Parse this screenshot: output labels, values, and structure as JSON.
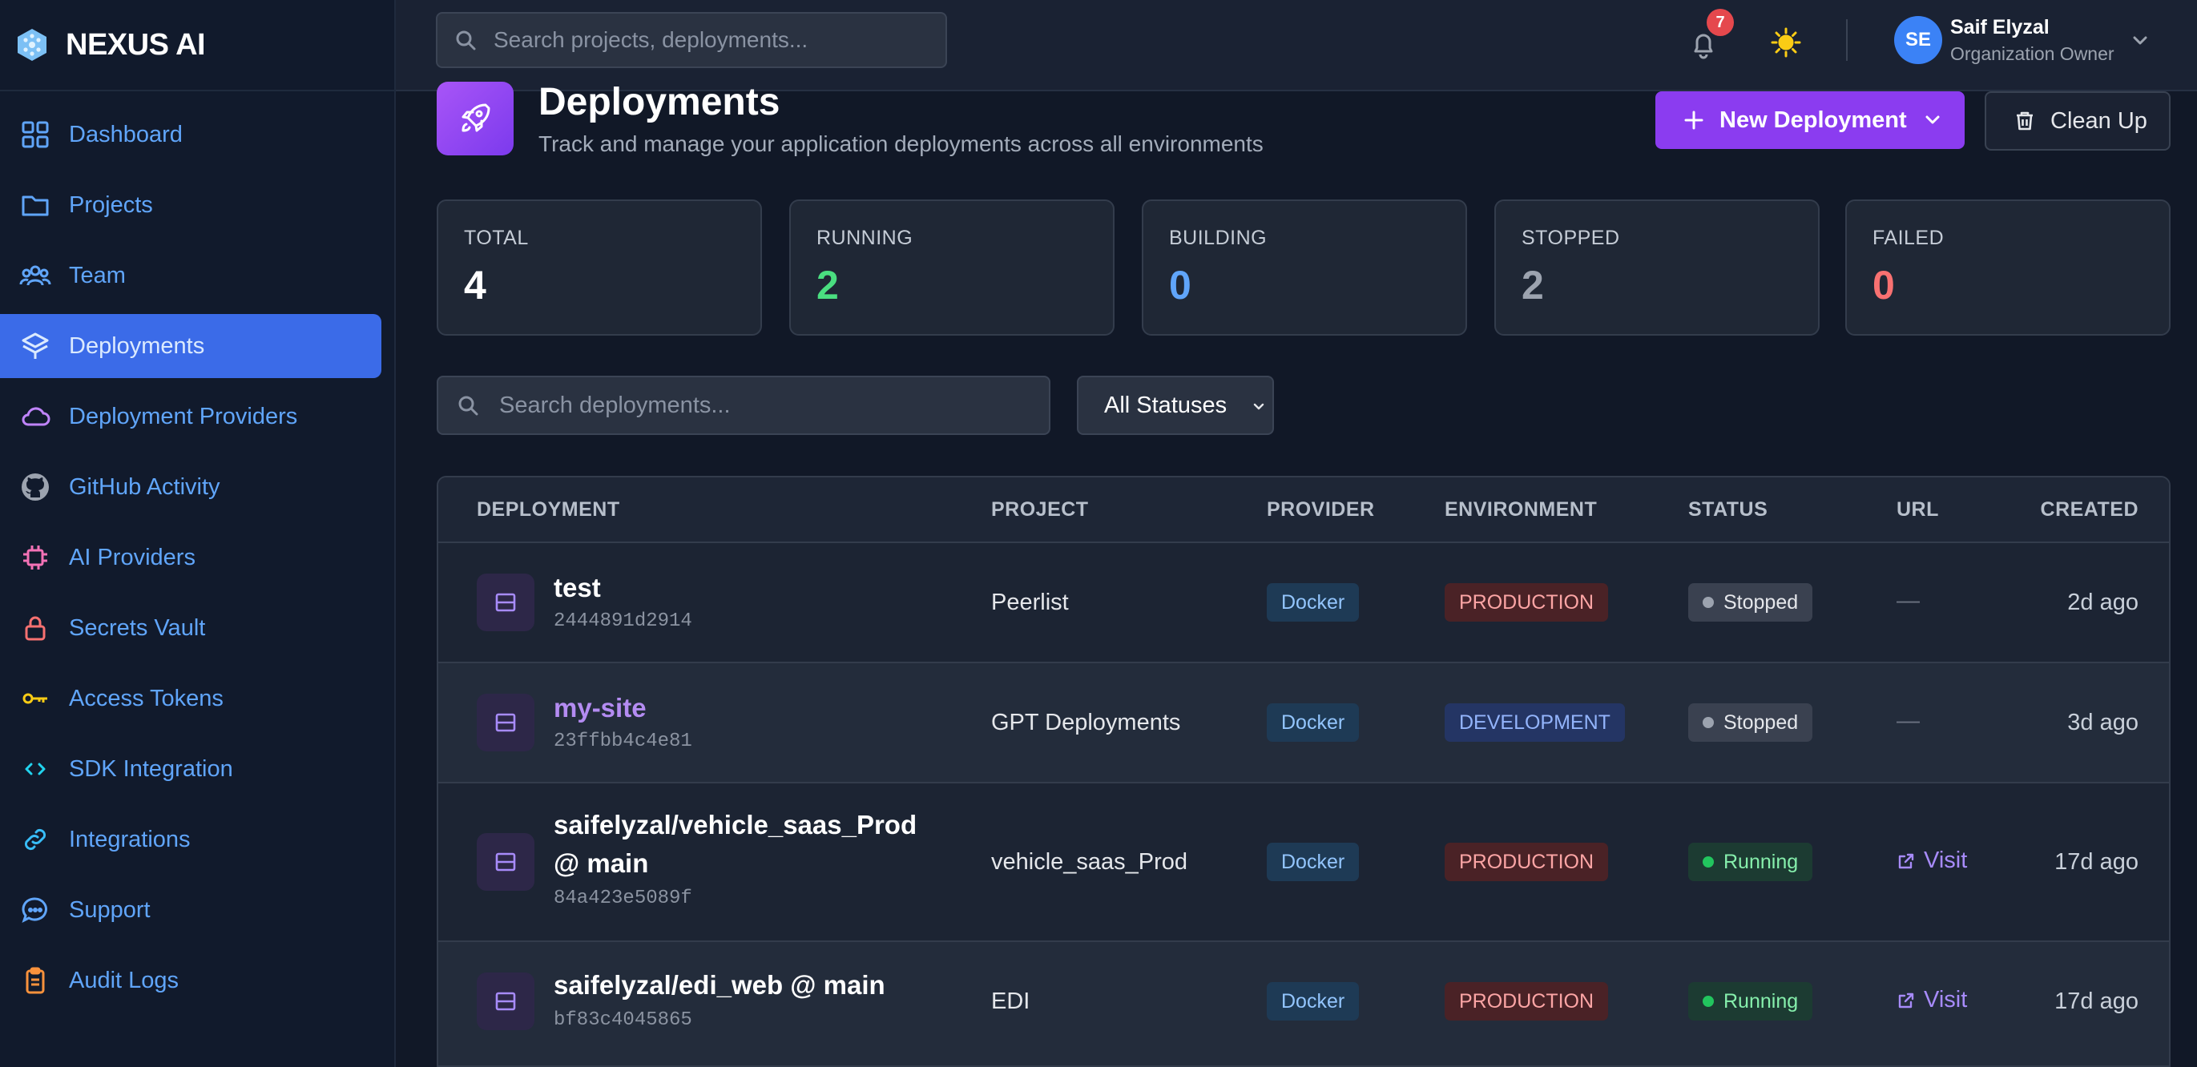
{
  "brand": {
    "name": "NEXUS AI"
  },
  "sidebar": {
    "items": [
      {
        "label": "Dashboard",
        "icon": "dashboard-grid-icon"
      },
      {
        "label": "Projects",
        "icon": "folder-icon"
      },
      {
        "label": "Team",
        "icon": "team-icon"
      },
      {
        "label": "Deployments",
        "icon": "layers-icon",
        "active": true
      },
      {
        "label": "Deployment Providers",
        "icon": "cloud-icon"
      },
      {
        "label": "GitHub Activity",
        "icon": "github-icon"
      },
      {
        "label": "AI Providers",
        "icon": "cpu-icon"
      },
      {
        "label": "Secrets Vault",
        "icon": "lock-icon"
      },
      {
        "label": "Access Tokens",
        "icon": "key-icon"
      },
      {
        "label": "SDK Integration",
        "icon": "code-icon"
      },
      {
        "label": "Integrations",
        "icon": "link-icon"
      },
      {
        "label": "Support",
        "icon": "chat-icon"
      },
      {
        "label": "Audit Logs",
        "icon": "clipboard-icon"
      }
    ]
  },
  "topbar": {
    "search_placeholder": "Search projects, deployments...",
    "notifications_count": "7",
    "user": {
      "initials": "SE",
      "name": "Saif Elyzal",
      "role": "Organization Owner"
    }
  },
  "page": {
    "title": "Deployments",
    "subtitle": "Track and manage your application deployments across all environments",
    "new_button": "New Deployment",
    "cleanup_button": "Clean Up"
  },
  "stats": [
    {
      "label": "TOTAL",
      "value": "4",
      "color": "#ffffff"
    },
    {
      "label": "RUNNING",
      "value": "2",
      "color": "#4ade80"
    },
    {
      "label": "BUILDING",
      "value": "0",
      "color": "#60a5fa"
    },
    {
      "label": "STOPPED",
      "value": "2",
      "color": "#9ca3af"
    },
    {
      "label": "FAILED",
      "value": "0",
      "color": "#f87171"
    }
  ],
  "filters": {
    "search_placeholder": "Search deployments...",
    "status_selected": "All Statuses"
  },
  "table": {
    "headers": {
      "deployment": "DEPLOYMENT",
      "project": "PROJECT",
      "provider": "PROVIDER",
      "environment": "ENVIRONMENT",
      "status": "STATUS",
      "url": "URL",
      "created": "CREATED"
    },
    "rows": [
      {
        "name": "test",
        "hash": "2444891d2914",
        "project": "Peerlist",
        "provider": "Docker",
        "environment": "PRODUCTION",
        "status": "Stopped",
        "url": "—",
        "created": "2d ago"
      },
      {
        "name": "my-site",
        "hash": "23ffbb4c4e81",
        "project": "GPT Deployments",
        "provider": "Docker",
        "environment": "DEVELOPMENT",
        "status": "Stopped",
        "url": "—",
        "created": "3d ago"
      },
      {
        "name_line1": "saifelyzal/vehicle_saas_Prod",
        "name_line2": "@ main",
        "hash": "84a423e5089f",
        "project": "vehicle_saas_Prod",
        "provider": "Docker",
        "environment": "PRODUCTION",
        "status": "Running",
        "url": "Visit",
        "created": "17d ago"
      },
      {
        "name": "saifelyzal/edi_web @ main",
        "hash": "bf83c4045865",
        "project": "EDI",
        "provider": "Docker",
        "environment": "PRODUCTION",
        "status": "Running",
        "url": "Visit",
        "created": "17d ago"
      }
    ]
  }
}
